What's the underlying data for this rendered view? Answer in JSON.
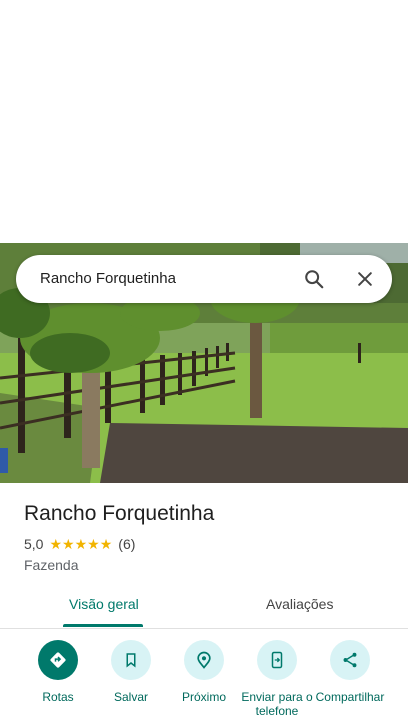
{
  "search": {
    "query": "Rancho Forquetinha"
  },
  "place": {
    "name": "Rancho Forquetinha",
    "rating": "5,0",
    "stars": 5,
    "review_count": "(6)",
    "category": "Fazenda"
  },
  "tabs": [
    {
      "label": "Visão geral",
      "active": true
    },
    {
      "label": "Avaliações",
      "active": false
    }
  ],
  "actions": [
    {
      "label": "Rotas",
      "icon": "directions-icon"
    },
    {
      "label": "Salvar",
      "icon": "bookmark-icon"
    },
    {
      "label": "Próximo",
      "icon": "nearby-icon"
    },
    {
      "label": "Enviar para o telefone",
      "icon": "send-to-phone-icon"
    },
    {
      "label": "Compartilhar",
      "icon": "share-icon"
    }
  ],
  "colors": {
    "accent": "#00796b",
    "star": "#f2b400",
    "action_bg": "#d8f3f5"
  }
}
